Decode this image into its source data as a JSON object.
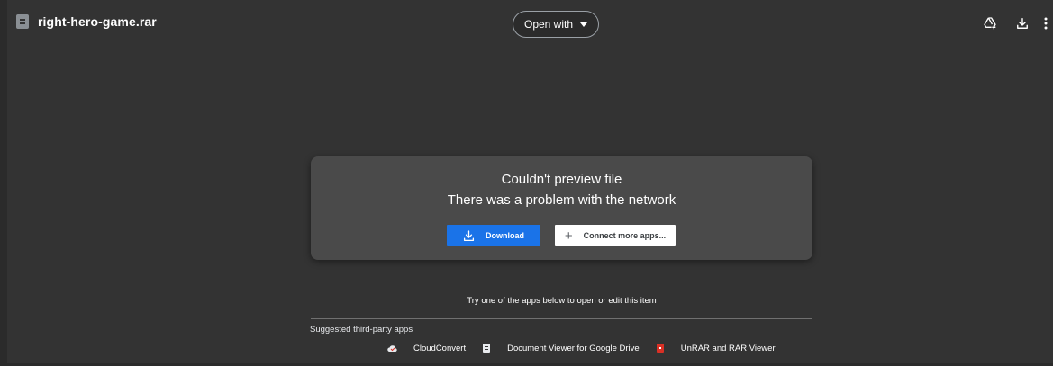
{
  "header": {
    "file_name": "right-hero-game.rar",
    "open_with_label": "Open with",
    "actions": [
      {
        "icon": "add-to-drive-icon"
      },
      {
        "icon": "download-icon"
      },
      {
        "icon": "more-vert-icon"
      }
    ]
  },
  "card": {
    "title": "Couldn't preview file",
    "subtitle": "There was a problem with the network",
    "download_label": "Download",
    "connect_label": "Connect more apps..."
  },
  "apps_section": {
    "prompt": "Try one of the apps below to open or edit this item",
    "suggested_label": "Suggested third-party apps",
    "apps": [
      {
        "name": "CloudConvert",
        "icon": "cloudconvert-icon"
      },
      {
        "name": "Document Viewer for Google Drive",
        "icon": "document-viewer-icon"
      },
      {
        "name": "UnRAR and RAR Viewer",
        "icon": "unrar-icon"
      }
    ]
  },
  "colors": {
    "background": "#333333",
    "card": "#4a4a4a",
    "accent_blue": "#1a73e8",
    "rar_red": "#d93025"
  }
}
